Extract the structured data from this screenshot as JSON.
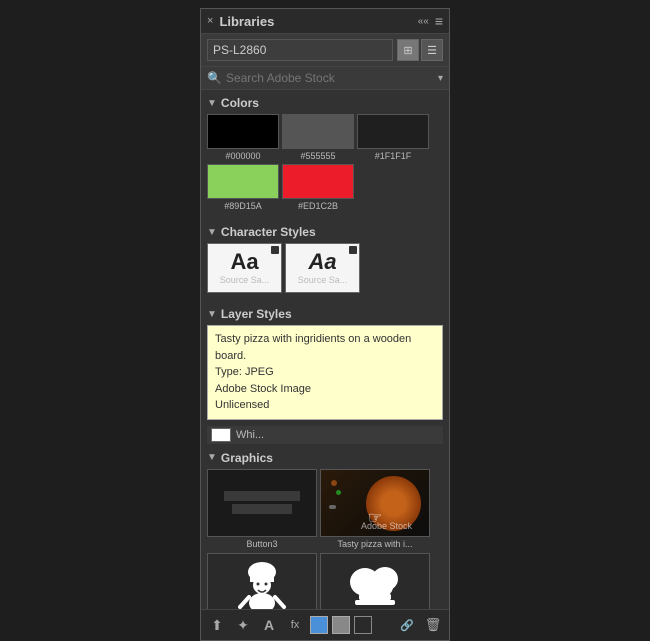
{
  "panel": {
    "title": "Libraries",
    "close_label": "×",
    "collapse_label": "««",
    "menu_label": "≡"
  },
  "dropdown": {
    "selected": "PS-L2860",
    "view_grid_label": "⊞",
    "view_list_label": "☰"
  },
  "search": {
    "placeholder": "Search Adobe Stock",
    "dropdown_arrow": "▾"
  },
  "sections": {
    "colors": {
      "label": "Colors",
      "arrow": "▼",
      "items": [
        {
          "hex": "#000000",
          "label": "#000000"
        },
        {
          "hex": "#555555",
          "label": "#555555"
        },
        {
          "hex": "#1F1F1F",
          "label": "#1F1F1F"
        },
        {
          "hex": "#89D15A",
          "label": "#89D15A"
        },
        {
          "hex": "#ED1C2B",
          "label": "#ED1C2B"
        }
      ]
    },
    "character_styles": {
      "label": "Character Styles",
      "arrow": "▼",
      "items": [
        {
          "label": "Source Sa...",
          "corner": true
        },
        {
          "label": "Source Sa...",
          "corner": true
        }
      ]
    },
    "layer_styles": {
      "label": "Layer Styles",
      "arrow": "▼"
    },
    "graphics": {
      "label": "Graphics",
      "arrow": "▼"
    }
  },
  "tooltip": {
    "title": "Tasty pizza with ingridients on a wooden board.",
    "type": "Type: JPEG",
    "source": "Adobe Stock Image",
    "license": "Unlicensed"
  },
  "layer_items": [
    {
      "label": "Whi...",
      "bg": "#ffffff"
    }
  ],
  "graphics_items": [
    {
      "label": "Button3",
      "type": "button"
    },
    {
      "label": "Tasty pizza with i...",
      "type": "pizza"
    }
  ],
  "bottom_icons": [
    {
      "name": "upload-icon",
      "symbol": "⬆"
    },
    {
      "name": "brush-icon",
      "symbol": "✦"
    },
    {
      "name": "text-icon",
      "symbol": "A"
    },
    {
      "name": "fx-icon",
      "symbol": "fx"
    },
    {
      "name": "color-box-blue",
      "symbol": "",
      "color": "#4a90d9"
    },
    {
      "name": "color-box-gray",
      "symbol": "",
      "color": "#888888"
    },
    {
      "name": "color-box-dark",
      "symbol": "",
      "color": "#2a2a2a"
    },
    {
      "name": "link-icon",
      "symbol": "🔗"
    },
    {
      "name": "trash-icon",
      "symbol": "🗑"
    }
  ]
}
